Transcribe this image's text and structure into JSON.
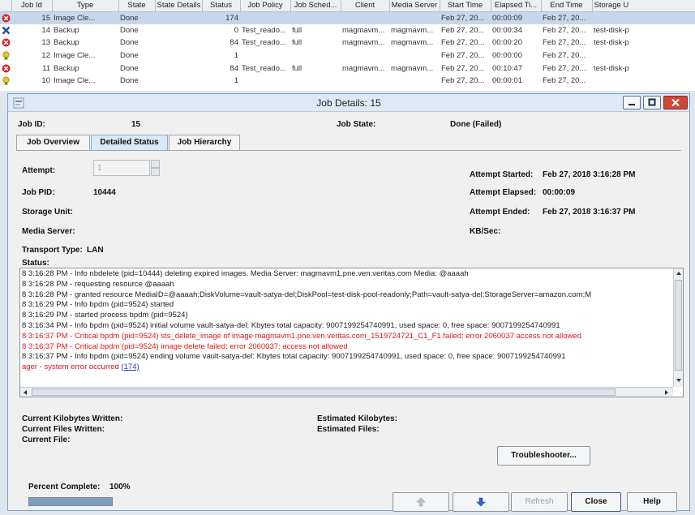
{
  "job_table": {
    "columns": [
      "Job Id",
      "Type",
      "State",
      "State Details",
      "Status",
      "Job Policy",
      "Job Sched...",
      "Client",
      "Media Server",
      "Start Time",
      "Elapsed Ti...",
      "End Time",
      "Storage U"
    ],
    "rows": [
      {
        "icon": "error-icon",
        "job_id": "15",
        "type": "Image Cle...",
        "state": "Done",
        "state_details": "",
        "status": "174",
        "policy": "",
        "schedule": "",
        "client": "",
        "media_server": "",
        "start": "Feb 27, 20...",
        "elapsed": "00:00:09",
        "end": "Feb 27, 20...",
        "storage": "",
        "selected": true
      },
      {
        "icon": "cancelled-icon",
        "job_id": "14",
        "type": "Backup",
        "state": "Done",
        "state_details": "",
        "status": "0",
        "policy": "Test_reado...",
        "schedule": "full",
        "client": "magmavm...",
        "media_server": "magmavm...",
        "start": "Feb 27, 20...",
        "elapsed": "00:00:34",
        "end": "Feb 27, 20...",
        "storage": "test-disk-p",
        "selected": false
      },
      {
        "icon": "error-icon",
        "job_id": "13",
        "type": "Backup",
        "state": "Done",
        "state_details": "",
        "status": "84",
        "policy": "Test_reado...",
        "schedule": "full",
        "client": "magmavm...",
        "media_server": "magmavm...",
        "start": "Feb 27, 20...",
        "elapsed": "00:00:20",
        "end": "Feb 27, 20...",
        "storage": "test-disk-p",
        "selected": false
      },
      {
        "icon": "warning-icon",
        "job_id": "12",
        "type": "Image Cle...",
        "state": "Done",
        "state_details": "",
        "status": "1",
        "policy": "",
        "schedule": "",
        "client": "",
        "media_server": "",
        "start": "Feb 27, 20...",
        "elapsed": "00:00:00",
        "end": "Feb 27, 20...",
        "storage": "",
        "selected": false
      },
      {
        "icon": "error-icon",
        "job_id": "11",
        "type": "Backup",
        "state": "Done",
        "state_details": "",
        "status": "84",
        "policy": "Test_reado...",
        "schedule": "full",
        "client": "magmavm...",
        "media_server": "magmavm...",
        "start": "Feb 27, 20...",
        "elapsed": "00:10:47",
        "end": "Feb 27, 20...",
        "storage": "test-disk-p",
        "selected": false
      },
      {
        "icon": "warning-icon",
        "job_id": "10",
        "type": "Image Cle...",
        "state": "Done",
        "state_details": "",
        "status": "1",
        "policy": "",
        "schedule": "",
        "client": "",
        "media_server": "",
        "start": "Feb 27, 20...",
        "elapsed": "00:00:01",
        "end": "Feb 27, 20...",
        "storage": "",
        "selected": false
      }
    ]
  },
  "dialog": {
    "title": "Job Details: 15",
    "job_id_label": "Job ID:",
    "job_id": "15",
    "job_state_label": "Job State:",
    "job_state": "Done (Failed)",
    "tabs": [
      {
        "label": "Job Overview",
        "active": false
      },
      {
        "label": "Detailed Status",
        "active": true
      },
      {
        "label": "Job Hierarchy",
        "active": false
      }
    ],
    "attempt_label": "Attempt:",
    "attempt_value": "1",
    "job_pid_label": "Job PID:",
    "job_pid": "10444",
    "storage_unit_label": "Storage Unit:",
    "storage_unit": "",
    "media_server_label": "Media Server:",
    "media_server": "",
    "transport_type_label": "Transport Type:",
    "transport_type": "LAN",
    "attempt_started_label": "Attempt Started:",
    "attempt_started": "Feb 27, 2018 3:16:28 PM",
    "attempt_elapsed_label": "Attempt Elapsed:",
    "attempt_elapsed": "00:00:09",
    "attempt_ended_label": "Attempt Ended:",
    "attempt_ended": "Feb 27, 2018 3:16:37 PM",
    "kbsec_label": "KB/Sec:",
    "kbsec": "",
    "status_label": "Status:",
    "log_lines": [
      {
        "text": "8 3:16:28 PM - Info nbdelete (pid=10444) deleting expired images. Media Server: magmavm1.pne.ven.veritas.com Media: @aaaah",
        "kind": "info"
      },
      {
        "text": "8 3:16:28 PM - requesting resource  @aaaah",
        "kind": "info"
      },
      {
        "text": "8 3:16:28 PM - granted resource  MediaID=@aaaah;DiskVolume=vault-satya-del;DiskPool=test-disk-pool-readonly;Path=vault-satya-del;StorageServer=amazon.com;M",
        "kind": "info"
      },
      {
        "text": "8 3:16:29 PM - Info bpdm (pid=9524) started",
        "kind": "info"
      },
      {
        "text": "8 3:16:29 PM - started process bpdm (pid=9524)",
        "kind": "info"
      },
      {
        "text": "8 3:16:34 PM - Info bpdm (pid=9524) initial volume vault-satya-del: Kbytes total capacity: 9007199254740991, used space: 0, free space: 9007199254740991",
        "kind": "info"
      },
      {
        "text": "8 3:16:37 PM - Critical bpdm (pid=9524) sts_delete_image of image magmavm1.pne.ven.veritas.com_1519724721_C1_F1 failed: error 2060037 access not allowed",
        "kind": "err"
      },
      {
        "text": "8 3:16:37 PM - Critical bpdm (pid=9524) image delete failed: error 2060037: access not allowed",
        "kind": "err"
      },
      {
        "text": "8 3:16:37 PM - Info bpdm (pid=9524) ending volume vault-satya-del: Kbytes total capacity: 9007199254740991, used space: 0, free space: 9007199254740991",
        "kind": "info"
      }
    ],
    "final_line_text": "ager - system error occurred",
    "final_line_link": "(174)",
    "current_kb_written_label": "Current Kilobytes Written:",
    "current_files_written_label": "Current Files Written:",
    "current_file_label": "Current File:",
    "estimated_kb_label": "Estimated Kilobytes:",
    "estimated_files_label": "Estimated Files:",
    "troubleshooter_label": "Troubleshooter...",
    "percent_complete_label": "Percent Complete:",
    "percent_complete": "100%",
    "percent_value": 100,
    "refresh_label": "Refresh",
    "close_label": "Close",
    "help_label": "Help"
  }
}
